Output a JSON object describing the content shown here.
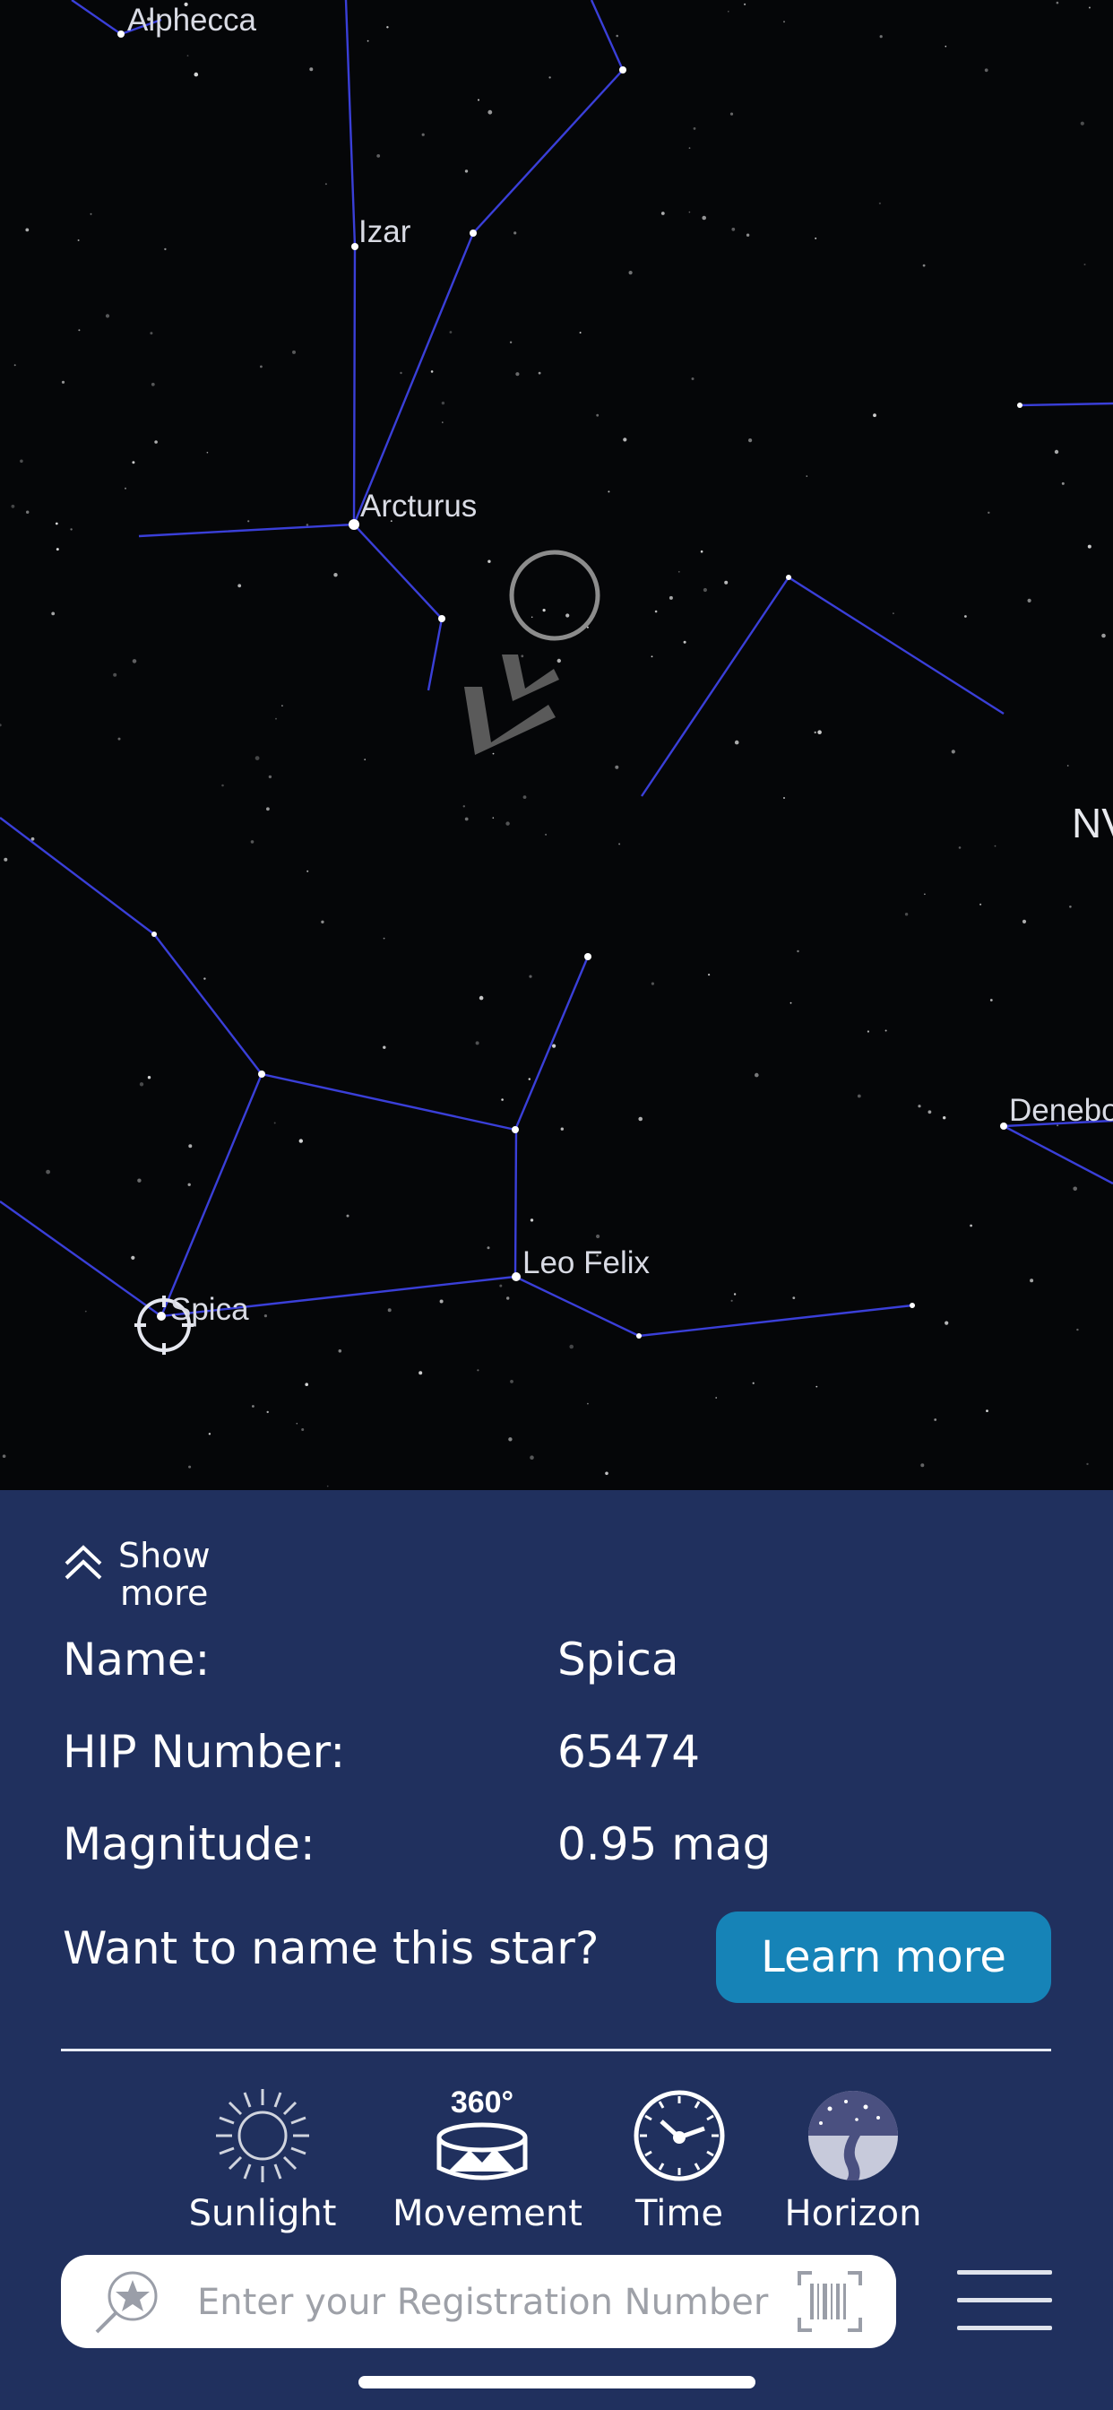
{
  "sky": {
    "stars": [
      {
        "name": "Alphecca"
      },
      {
        "name": "Izar"
      },
      {
        "name": "Arcturus"
      },
      {
        "name": "Leo Felix"
      },
      {
        "name": "Spica"
      },
      {
        "name": "Denebo"
      }
    ],
    "compass": "NV",
    "colors": {
      "background": "#050608",
      "constellation": "#3a3fd8",
      "label": "#d9dbe4"
    }
  },
  "panel": {
    "show_more": {
      "line1": "Show",
      "line2": "more"
    },
    "details": [
      {
        "label": "Name:",
        "value": "Spica"
      },
      {
        "label": "HIP Number:",
        "value": "65474"
      },
      {
        "label": "Magnitude:",
        "value": "0.95 mag"
      }
    ],
    "cta": {
      "question": "Want to name this star?",
      "button": "Learn more"
    },
    "tools": [
      {
        "label": "Sunlight",
        "icon": "sun-icon"
      },
      {
        "label": "Movement",
        "icon": "360-movement-icon"
      },
      {
        "label": "Time",
        "icon": "clock-icon"
      },
      {
        "label": "Horizon",
        "icon": "horizon-icon"
      }
    ],
    "tool_360_text": "360°",
    "search": {
      "placeholder": "Enter your Registration Number"
    },
    "colors": {
      "panel": "#20305e",
      "button": "#1683b7"
    }
  }
}
